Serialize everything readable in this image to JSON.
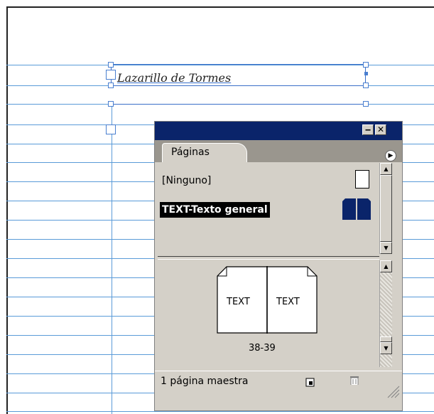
{
  "document": {
    "heading_text": "Lazarillo de Tormes"
  },
  "panel": {
    "title_minimize": "‒",
    "title_close": "✕",
    "tab_label": "Páginas",
    "menu_icon": "flyout-menu-icon",
    "masters": [
      {
        "label": "[Ninguno]",
        "selected": false
      },
      {
        "label": "TEXT-Texto general",
        "selected": true
      }
    ],
    "spread": {
      "left_label": "TEXT",
      "right_label": "TEXT",
      "page_numbers": "38-39"
    },
    "footer": {
      "status": "1 página maestra",
      "new_page_icon": "new-page-icon",
      "trash_icon": "trash-icon"
    }
  },
  "colors": {
    "guide": "#5a9bd8",
    "titlebar": "#0a246a",
    "panel_bg": "#d4d0c8",
    "master_icon": "#0a246a"
  }
}
